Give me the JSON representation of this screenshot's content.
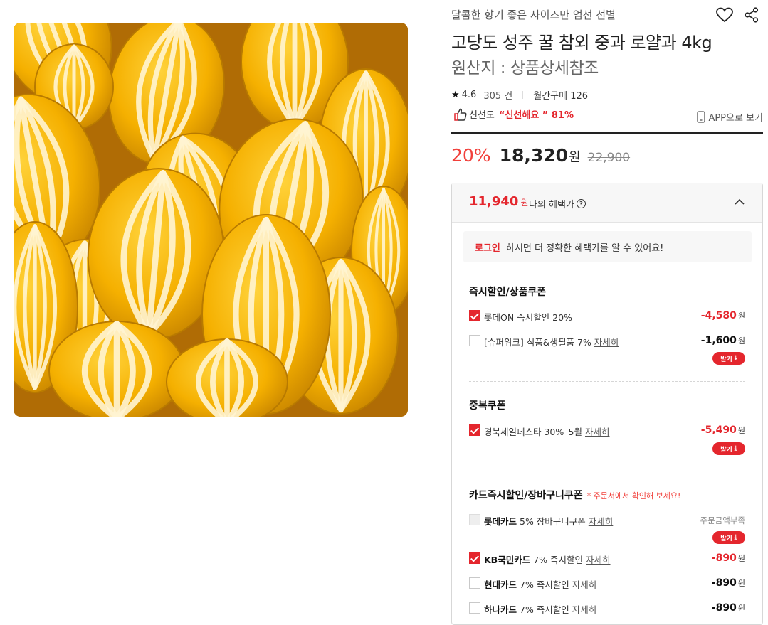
{
  "product": {
    "subtitle": "달콤한 향기 좋은 사이즈만 엄선 선별",
    "title": "고당도 성주 꿀 참외 중과 로얄과 4kg",
    "origin": "원산지 : 상품상세참조"
  },
  "rating": {
    "score": "4.6",
    "reviews": "305 건",
    "monthly_sales": "월간구매 126"
  },
  "freshness": {
    "label": "신선도",
    "highlight": "“신선해요 ” 81%"
  },
  "app_link": "APP으로 보기",
  "price": {
    "discount_rate": "20%",
    "sale_price": "18,320",
    "won": "원",
    "original_price": "22,900"
  },
  "benefit": {
    "price": "11,940",
    "won": "원",
    "label": "나의 혜택가",
    "login_link": "로그인",
    "login_text": "하시면 더 정확한 혜택가를 알 수 있어요!",
    "sections": [
      {
        "title": "즉시할인/상품쿠폰",
        "items": [
          {
            "checked": true,
            "brand": "",
            "label": "롯데ON 즉시할인 20%",
            "more": "",
            "amount": "-4,580",
            "won": "원",
            "button": ""
          },
          {
            "checked": false,
            "brand": "",
            "label": "[슈퍼위크] 식품&생필품 7%",
            "more": "자세히",
            "amount": "-1,600",
            "won": "원",
            "button": "받기"
          }
        ]
      },
      {
        "title": "중복쿠폰",
        "items": [
          {
            "checked": true,
            "brand": "",
            "label": "경북세일페스타 30%_5월",
            "more": "자세히",
            "amount": "-5,490",
            "won": "원",
            "button": "받기"
          }
        ]
      },
      {
        "title": "카드즉시할인/장바구니쿠폰",
        "note": "* 주문서에서 확인해 보세요!",
        "items": [
          {
            "checked": false,
            "disabled": true,
            "brand": "롯데카드",
            "label": " 5% 장바구니쿠폰",
            "more": "자세히",
            "amount_note": "주문금액부족",
            "button": "받기"
          },
          {
            "checked": true,
            "brand": "KB국민카드",
            "label": " 7% 즉시할인",
            "more": "자세히",
            "amount": "-890",
            "won": "원"
          },
          {
            "checked": false,
            "brand": "현대카드",
            "label": " 7% 즉시할인",
            "more": "자세히",
            "amount": "-890",
            "won": "원"
          },
          {
            "checked": false,
            "brand": "하나카드",
            "label": " 7% 즉시할인",
            "more": "자세히",
            "amount": "-890",
            "won": "원"
          }
        ]
      }
    ]
  },
  "icons": {
    "like": "heart-icon",
    "share": "share-icon",
    "star": "star-icon",
    "thumbs": "thumbs-up-icon",
    "phone": "phone-icon",
    "toggle": "chevron-up-icon",
    "download": "download-icon"
  },
  "colors": {
    "accent_red": "#e4262d",
    "discount_red": "#f1403b",
    "melon_yellow": "#f7b800"
  }
}
